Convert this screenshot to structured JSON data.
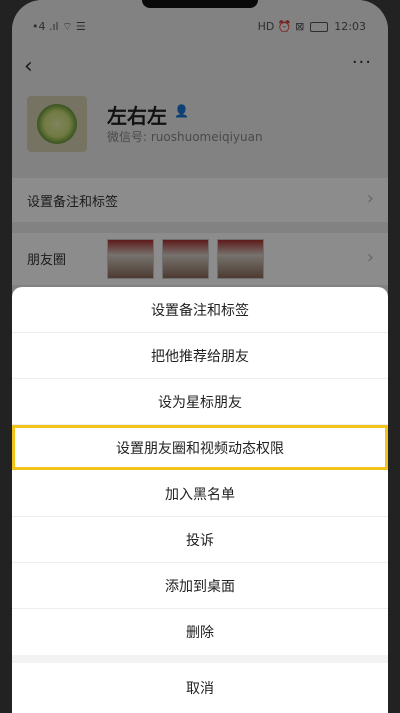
{
  "status_bar": {
    "left": "•4 .ıl ⌔ ☰",
    "right_icons": "HD ⏰ ⊠",
    "time": "12:03"
  },
  "navbar": {
    "back_icon": "‹",
    "more_icon": "···"
  },
  "profile": {
    "name": "左右左",
    "wechat_id_label": "微信号:",
    "wechat_id": "ruoshuomeiqiyuan"
  },
  "rows": {
    "remark_label": "设置备注和标签",
    "moments_label": "朋友圈"
  },
  "sheet": {
    "items": [
      "设置备注和标签",
      "把他推荐给朋友",
      "设为星标朋友",
      "设置朋友圈和视频动态权限",
      "加入黑名单",
      "投诉",
      "添加到桌面",
      "删除"
    ],
    "cancel": "取消"
  },
  "colors": {
    "highlight": "#f2c31b"
  }
}
